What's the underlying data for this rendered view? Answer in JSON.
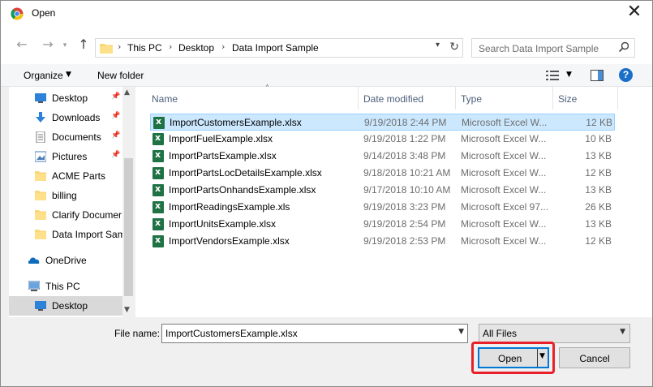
{
  "window": {
    "title": "Open",
    "close_glyph": "✕"
  },
  "nav": {
    "back_glyph": "←",
    "forward_glyph": "→",
    "up_glyph": "↑",
    "breadcrumb": [
      "This PC",
      "Desktop",
      "Data Import Sample"
    ],
    "separator": "›",
    "search_placeholder": "Search Data Import Sample"
  },
  "toolbar": {
    "organize": "Organize",
    "new_folder": "New folder",
    "help": "?"
  },
  "sidebar": {
    "items": [
      {
        "label": "Desktop",
        "icon": "desktop-icon",
        "pinned": true
      },
      {
        "label": "Downloads",
        "icon": "download-icon",
        "pinned": true
      },
      {
        "label": "Documents",
        "icon": "documents-icon",
        "pinned": true
      },
      {
        "label": "Pictures",
        "icon": "pictures-icon",
        "pinned": true
      },
      {
        "label": "ACME Parts",
        "icon": "folder-icon",
        "pinned": false
      },
      {
        "label": "billing",
        "icon": "folder-icon",
        "pinned": false
      },
      {
        "label": "Clarify Documer",
        "icon": "folder-icon",
        "pinned": false
      },
      {
        "label": "Data Import Sam",
        "icon": "folder-icon",
        "pinned": false
      },
      {
        "label": "OneDrive",
        "icon": "onedrive-icon",
        "pinned": false
      },
      {
        "label": "This PC",
        "icon": "computer-icon",
        "pinned": false
      },
      {
        "label": "Desktop",
        "icon": "desktop-icon",
        "pinned": false
      }
    ]
  },
  "columns": {
    "name": "Name",
    "date": "Date modified",
    "type": "Type",
    "size": "Size"
  },
  "files": [
    {
      "name": "ImportCustomersExample.xlsx",
      "date": "9/19/2018 2:44 PM",
      "type": "Microsoft Excel W...",
      "size": "12 KB"
    },
    {
      "name": "ImportFuelExample.xlsx",
      "date": "9/19/2018 1:22 PM",
      "type": "Microsoft Excel W...",
      "size": "10 KB"
    },
    {
      "name": "ImportPartsExample.xlsx",
      "date": "9/14/2018 3:48 PM",
      "type": "Microsoft Excel W...",
      "size": "13 KB"
    },
    {
      "name": "ImportPartsLocDetailsExample.xlsx",
      "date": "9/18/2018 10:21 AM",
      "type": "Microsoft Excel W...",
      "size": "12 KB"
    },
    {
      "name": "ImportPartsOnhandsExample.xlsx",
      "date": "9/17/2018 10:10 AM",
      "type": "Microsoft Excel W...",
      "size": "13 KB"
    },
    {
      "name": "ImportReadingsExample.xls",
      "date": "9/19/2018 3:23 PM",
      "type": "Microsoft Excel 97...",
      "size": "26 KB"
    },
    {
      "name": "ImportUnitsExample.xlsx",
      "date": "9/19/2018 2:54 PM",
      "type": "Microsoft Excel W...",
      "size": "13 KB"
    },
    {
      "name": "ImportVendorsExample.xlsx",
      "date": "9/19/2018 2:53 PM",
      "type": "Microsoft Excel W...",
      "size": "12 KB"
    }
  ],
  "footer": {
    "file_name_label": "File name:",
    "file_name_value": "ImportCustomersExample.xlsx",
    "filter_value": "All Files",
    "open_label": "Open",
    "cancel_label": "Cancel"
  },
  "colors": {
    "accent": "#0078d7",
    "selection": "#cce8ff",
    "highlight_box": "#e8202a"
  }
}
